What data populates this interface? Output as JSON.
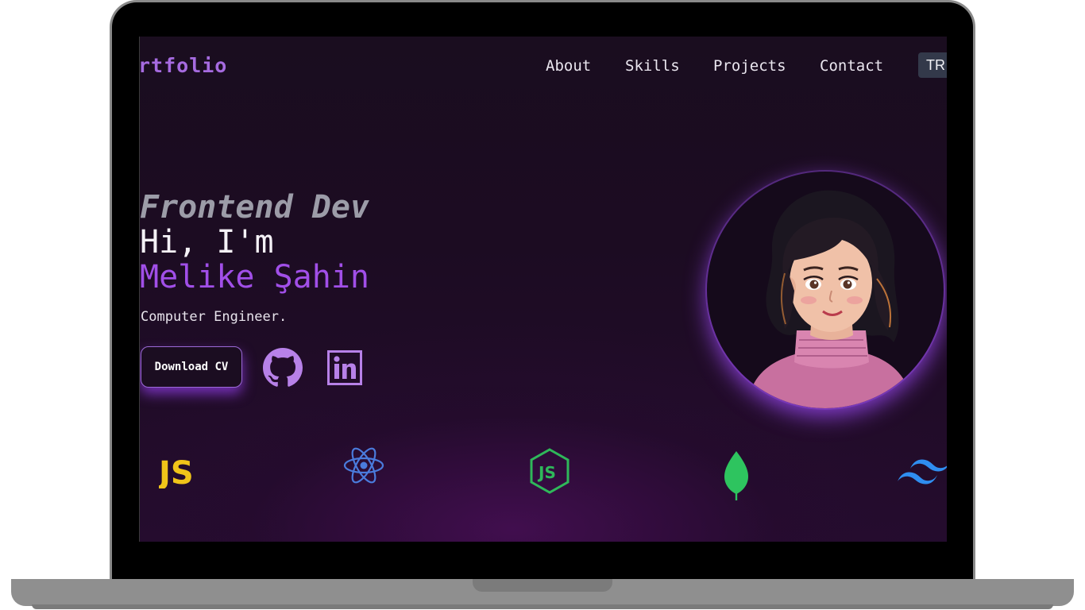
{
  "logo": {
    "text": "rtfolio"
  },
  "nav": {
    "links": [
      "About",
      "Skills",
      "Projects",
      "Contact"
    ],
    "language": "TR"
  },
  "hero": {
    "role": "Frontend Dev",
    "greeting": "Hi, I'm",
    "name": "Melike Şahin",
    "title": "Computer Engineer.",
    "cv_button": "Download CV"
  },
  "social": [
    "github-icon",
    "linkedin-icon"
  ],
  "tech_icons": [
    "javascript-icon",
    "react-icon",
    "nodejs-icon",
    "mongodb-icon",
    "tailwind-icon"
  ],
  "colors": {
    "accent": "#a14fe8",
    "background": "#1c0c22",
    "button_glow": "#923ce6",
    "nav_text": "#eae6ef",
    "javascript": "#f0c419",
    "react": "#4a7bdc",
    "nodejs": "#2fb85a",
    "mongodb": "#2ec45f",
    "tailwind": "#2f8ef0"
  }
}
